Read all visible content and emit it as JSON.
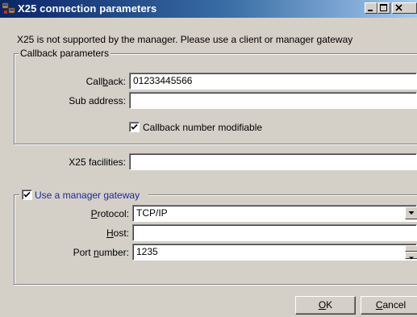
{
  "window": {
    "title": "X25 connection parameters",
    "icon": "network-computers-icon",
    "caption_buttons": [
      "minimize",
      "maximize",
      "close"
    ]
  },
  "notice": "X25 is not supported by the manager. Please use a client or manager gateway",
  "callback_group": {
    "legend": "Callback parameters",
    "callback": {
      "label_pre": "Call",
      "label_key": "b",
      "label_post": "ack:",
      "value": "01233445566"
    },
    "sub_address": {
      "label": "Sub address:",
      "value": ""
    },
    "modifiable": {
      "label": "Callback number modifiable",
      "checked": true
    }
  },
  "x25_facilities": {
    "label": "X25 facilities:",
    "value": ""
  },
  "gateway_group": {
    "legend": "Use a manager gateway",
    "checked": true,
    "protocol": {
      "label_key": "P",
      "label_post": "rotocol:",
      "value": "TCP/IP"
    },
    "host": {
      "label_key": "H",
      "label_post": "ost:",
      "value": ""
    },
    "port": {
      "label_pre": "Port ",
      "label_key": "n",
      "label_post": "umber:",
      "value": "1235"
    }
  },
  "buttons": {
    "ok": {
      "key": "O",
      "rest": "K"
    },
    "cancel": {
      "key": "C",
      "rest": "ancel"
    }
  },
  "colors": {
    "title_start": "#0a246a",
    "title_end": "#a6caf0",
    "face": "#d4d0c8",
    "legend_blue": "#1a2a9c"
  }
}
